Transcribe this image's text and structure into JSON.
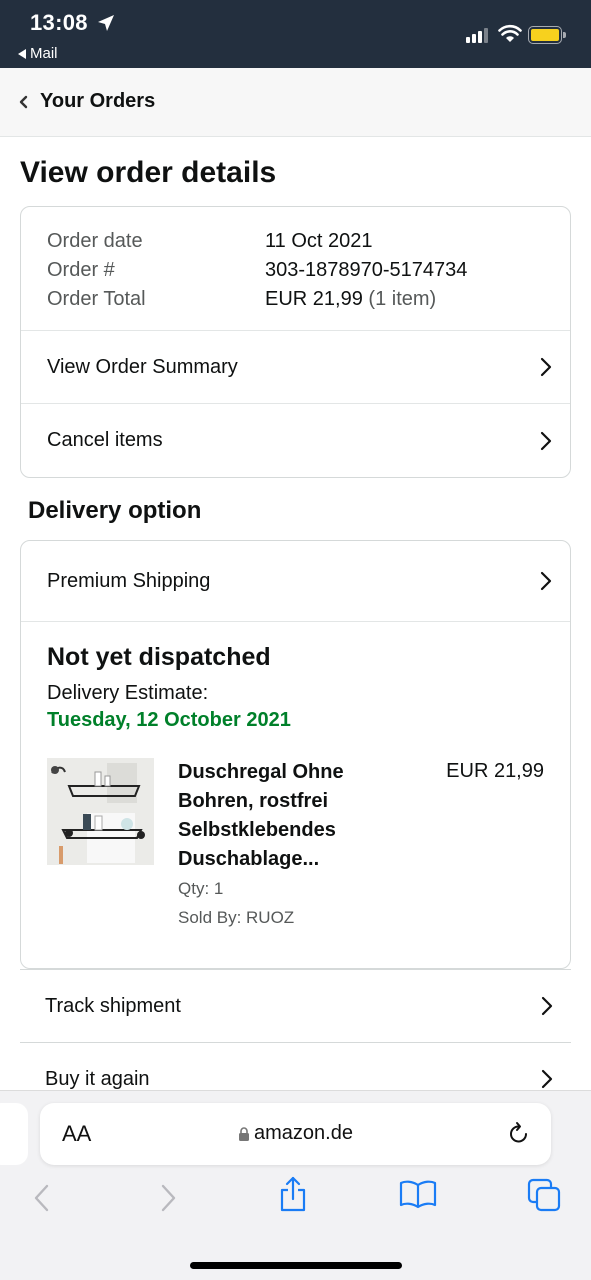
{
  "status_bar": {
    "time": "13:08",
    "back_app": "Mail",
    "battery_color": "#f7d11e"
  },
  "nav": {
    "back_label": "Your Orders"
  },
  "page": {
    "title": "View order details"
  },
  "order": {
    "date_label": "Order date",
    "date_value": "11 Oct 2021",
    "number_label": "Order #",
    "number_value": "303-1878970-5174734",
    "total_label": "Order Total",
    "total_value": "EUR 21,99",
    "total_items": "(1 item)",
    "summary_link": "View Order Summary",
    "cancel_link": "Cancel items"
  },
  "delivery": {
    "section_title": "Delivery option",
    "option": "Premium Shipping",
    "status": "Not yet dispatched",
    "estimate_label": "Delivery Estimate:",
    "estimate_date": "Tuesday, 12 October 2021",
    "estimate_color": "#00802a",
    "product": {
      "title": "Duschregal Ohne Bohren, rostfrei Selbstklebendes Duschablage...",
      "qty": "Qty: 1",
      "seller": "Sold By: RUOZ",
      "price": "EUR 21,99"
    }
  },
  "actions": {
    "track": "Track shipment",
    "buy_again": "Buy it again"
  },
  "browser": {
    "text_size": "AA",
    "url": "amazon.de"
  }
}
